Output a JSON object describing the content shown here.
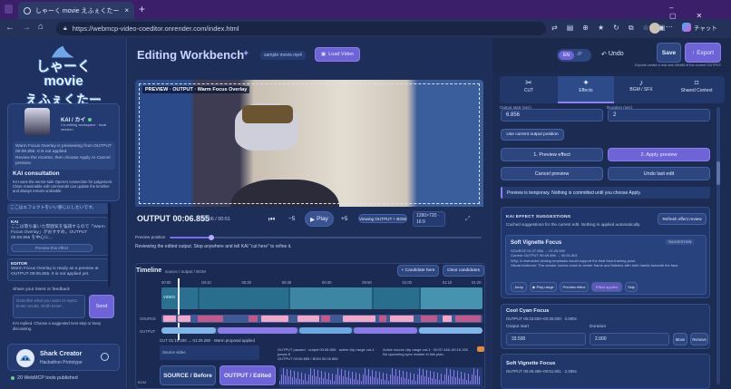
{
  "browser": {
    "tab_title": "しゃーく movie えふぇくたー — Editing",
    "url": "https://webmcp-video-coeditor.onrender.com/index.html",
    "assistant_label": "チャット",
    "new_tab": "+"
  },
  "sidebar": {
    "logo_lines": [
      "しゃーく",
      "movie",
      "えふぇくたー"
    ],
    "kai_name": "KAI / カイ",
    "kai_sub": "Co-editing workspace · local session",
    "kai_msg": "Warm Focus Overlay is previewing from OUTPUT 00:06.855. It is not applied.",
    "kai_msg2": "Review the monitor, then choose Apply or Cancel preview.",
    "consult_title": "KAI consultation",
    "consult_intro": "KAI uses the server-side OpenAI connection for judgement. Close reasonable edit commands can update the timeline and always remain undoable.",
    "consult_jp": "ここはエフェクトをいい感じにしたいです。",
    "kai_label": "KAI",
    "kai_reply": "ここは落ち着いた雰囲気を強調するので「Warm Focus Overlay」がおすすめ。OUTPUT 00:06.855 を中心に...",
    "preview_btn": "Preview this effect",
    "editor_label": "EDITOR",
    "editor_msg": "Warm Focus Overlay is ready as a preview at OUTPUT 00:06.855. It is not applied yet.",
    "share_label": "Share your intent or feedback",
    "share_placeholder": "Describe what you want or reject. Enter sends, Shift+Enter...",
    "send": "Send",
    "kai_status": "KAI replied. Choose a suggested next step or keep discussing.",
    "creator_name": "Shark Creator",
    "creator_sub": "Hackathon Prototype",
    "tools": "20 WebMCP tools published"
  },
  "header": {
    "title": "Editing Workbench",
    "sample": "sample movie.mp4",
    "load": "Load Video",
    "lang_en": "EN",
    "lang_jp": "JP",
    "undo": "Undo",
    "save": "Save",
    "export": "Export",
    "export_note": "Exports create a real new WebM of the current OUTPUT."
  },
  "monitor": {
    "label": "PREVIEW · OUTPUT · Warm Focus Overlay",
    "output_time": "OUTPUT 00:06.855",
    "frac": "00:06 / 00:51",
    "minus": "−5",
    "play": "Play",
    "plus": "+5",
    "viewing": "Viewing OUTPUT + BGM",
    "res": "1280×720 · 16:9",
    "preview_position_label": "Preview position",
    "preview_position": 0.134,
    "hint": "Reviewing the edited output. Stop anywhere and tell KAI \"cut here\" to refine it."
  },
  "timeline": {
    "title": "Timeline",
    "sub": "source / output / BGM",
    "cand": "+ Candidate here",
    "clear": "Clear candidates",
    "ticks": [
      "00:00",
      "00:10",
      "00:20",
      "00:30",
      "00:40",
      "00:50",
      "01:00",
      "01:10",
      "01:20"
    ],
    "video_label": "VIDEO",
    "source_label": "SOURCE",
    "output_label": "OUTPUT",
    "cut_info": "CUT 01:16.340 → 01:25.290 · Warm proposal applied",
    "paused": "OUTPUT paused · output 00:06.855 · active clip range cut-1 · jumps 8",
    "paused2": "OUTPUT 00:06.855 / BGM 00:06.855",
    "paused3": "Active source clip range cut-1 · 00:07.446–00:16.155",
    "paused4": "No upcoming sync marker in this plan.",
    "source_status": "Source video",
    "src_btn": "SOURCE / Before",
    "out_btn": "OUTPUT / Edited",
    "bgm_label": "BGM"
  },
  "panel": {
    "tabs": [
      "CUT",
      "Effects",
      "BGM / SFX",
      "Shared Context"
    ],
    "active_tab": 1,
    "out_start_label": "Output start (sec)",
    "duration_label": "Duration (sec)",
    "out_start": "6.856",
    "duration": "2",
    "use_current": "Use current output position",
    "preview_effect": "1. Preview effect",
    "apply_preview": "2. Apply preview",
    "cancel_preview": "Cancel preview",
    "undo_last": "Undo last edit",
    "temp_note": "Preview is temporary. Nothing is committed until you choose Apply.",
    "sugg_title": "KAI EFFECT SUGGESTIONS",
    "sugg_sub": "Cached suggestions for the current edit. Nothing is applied automatically.",
    "refresh": "Refresh effect review",
    "vignette_title": "Soft Vignette Focus",
    "suggestion_badge": "SUGGESTION",
    "vignette_l1": "SOURCE 01:27.554 → 01:25.500",
    "vignette_l2": "Current OUTPUT 00:49.496 → 00:51.801",
    "vignette_l3": "Why: A restrained closing emphasis would support the final face-framing pose.",
    "vignette_l4": "Visual evidence: The creator moves close to center frame and finishes with both hands beneath the face.",
    "btns": [
      "Jump",
      "Play range",
      "Preview effect",
      "Effect applied",
      "Skip"
    ],
    "cyan_title": "Cool Cyan Focus",
    "cyan_sub": "OUTPUT 00:33.500–00:35.500 · 2.000s",
    "out_start2_label": "Output start",
    "duration2_label": "Duration",
    "cyan_start": "33.500",
    "cyan_dur": "2.000",
    "move": "Move",
    "remove": "Remove",
    "vig2_title": "Soft Vignette Focus",
    "vig2_sub": "OUTPUT 00:49.496–00:51.801 · 2.305s"
  },
  "colors": {
    "accent": "#7a6cf0",
    "bg": "#1b2a4c",
    "card": "#243b72",
    "pink": "#f0a7c8",
    "magenta": "#c05a8a"
  }
}
